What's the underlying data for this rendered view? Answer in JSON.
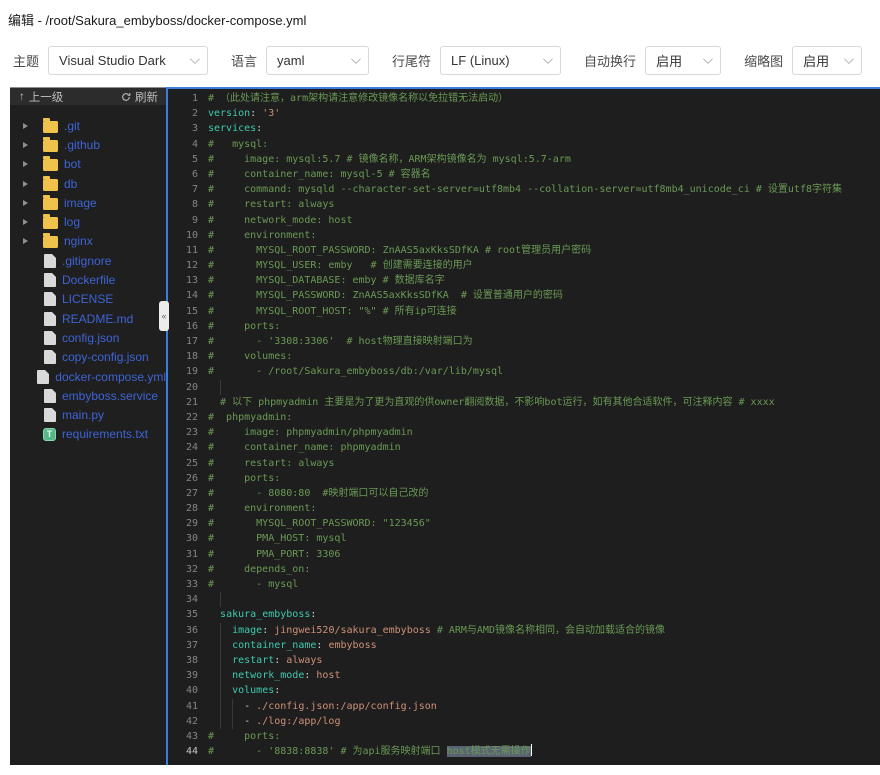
{
  "window": {
    "title": "编辑 - /root/Sakura_embyboss/docker-compose.yml"
  },
  "toolbar": {
    "fields": [
      {
        "label": "主题",
        "value": "Visual Studio Dark"
      },
      {
        "label": "语言",
        "value": "yaml"
      },
      {
        "label": "行尾符",
        "value": "LF (Linux)"
      },
      {
        "label": "自动换行",
        "value": "启用"
      },
      {
        "label": "缩略图",
        "value": "启用"
      }
    ]
  },
  "sidebar": {
    "up_label": "上一级",
    "refresh_label": "刷新",
    "collapse_icon": "«",
    "items": [
      {
        "name": ".git",
        "type": "folder"
      },
      {
        "name": ".github",
        "type": "folder"
      },
      {
        "name": "bot",
        "type": "folder"
      },
      {
        "name": "db",
        "type": "folder"
      },
      {
        "name": "image",
        "type": "folder"
      },
      {
        "name": "log",
        "type": "folder"
      },
      {
        "name": "nginx",
        "type": "folder"
      },
      {
        "name": ".gitignore",
        "type": "file"
      },
      {
        "name": "Dockerfile",
        "type": "file"
      },
      {
        "name": "LICENSE",
        "type": "file"
      },
      {
        "name": "README.md",
        "type": "file"
      },
      {
        "name": "config.json",
        "type": "file"
      },
      {
        "name": "copy-config.json",
        "type": "file"
      },
      {
        "name": "docker-compose.yml",
        "type": "file"
      },
      {
        "name": "embyboss.service",
        "type": "file"
      },
      {
        "name": "main.py",
        "type": "file"
      },
      {
        "name": "requirements.txt",
        "type": "txt"
      }
    ]
  },
  "colors": {
    "accent_blue": "#3b7ddd",
    "editor_bg": "#1e1e1e",
    "comment_green": "#6a9955",
    "key_teal": "#3dc9b0",
    "value_orange": "#ce9178",
    "selection_gray": "#5a6372",
    "tree_link_blue": "#3e63d6",
    "folder_yellow": "#f0c14b",
    "txt_icon_green": "#55b888"
  },
  "editor": {
    "lines": [
      {
        "n": 1,
        "tokens": [
          {
            "c": "c",
            "t": "# （此处请注意，arm架构请注意修改镜像名称以免拉错无法启动）"
          }
        ]
      },
      {
        "n": 2,
        "tokens": [
          {
            "c": "k",
            "t": "version"
          },
          {
            "c": "p",
            "t": ": "
          },
          {
            "c": "s",
            "t": "'3'"
          }
        ]
      },
      {
        "n": 3,
        "tokens": [
          {
            "c": "k",
            "t": "services"
          },
          {
            "c": "p",
            "t": ":"
          }
        ]
      },
      {
        "n": 4,
        "tokens": [
          {
            "c": "c",
            "t": "#   mysql:"
          }
        ]
      },
      {
        "n": 5,
        "tokens": [
          {
            "c": "c",
            "t": "#     image: mysql:5.7 # 镜像名称，ARM架构镜像名为 mysql:5.7-arm"
          }
        ]
      },
      {
        "n": 6,
        "tokens": [
          {
            "c": "c",
            "t": "#     container_name: mysql-5 # 容器名"
          }
        ]
      },
      {
        "n": 7,
        "tokens": [
          {
            "c": "c",
            "t": "#     command: mysqld --character-set-server=utf8mb4 --collation-server=utf8mb4_unicode_ci # 设置utf8字符集"
          }
        ]
      },
      {
        "n": 8,
        "tokens": [
          {
            "c": "c",
            "t": "#     restart: always"
          }
        ]
      },
      {
        "n": 9,
        "tokens": [
          {
            "c": "c",
            "t": "#     network_mode: host"
          }
        ]
      },
      {
        "n": 10,
        "tokens": [
          {
            "c": "c",
            "t": "#     environment:"
          }
        ]
      },
      {
        "n": 11,
        "tokens": [
          {
            "c": "c",
            "t": "#       MYSQL_ROOT_PASSWORD: ZnAAS5axKksSDfKA # root管理员用户密码"
          }
        ]
      },
      {
        "n": 12,
        "tokens": [
          {
            "c": "c",
            "t": "#       MYSQL_USER: emby   # 创建需要连接的用户"
          }
        ]
      },
      {
        "n": 13,
        "tokens": [
          {
            "c": "c",
            "t": "#       MYSQL_DATABASE: emby # 数据库名字"
          }
        ]
      },
      {
        "n": 14,
        "tokens": [
          {
            "c": "c",
            "t": "#       MYSQL_PASSWORD: ZnAAS5axKksSDfKA  # 设置普通用户的密码"
          }
        ]
      },
      {
        "n": 15,
        "tokens": [
          {
            "c": "c",
            "t": "#       MYSQL_ROOT_HOST: \"%\" # 所有ip可连接"
          }
        ]
      },
      {
        "n": 16,
        "tokens": [
          {
            "c": "c",
            "t": "#     ports:"
          }
        ]
      },
      {
        "n": 17,
        "tokens": [
          {
            "c": "c",
            "t": "#       - '3308:3306'  # host物理直接映射端口为"
          }
        ]
      },
      {
        "n": 18,
        "tokens": [
          {
            "c": "c",
            "t": "#     volumes:"
          }
        ]
      },
      {
        "n": 19,
        "tokens": [
          {
            "c": "c",
            "t": "#       - /root/Sakura_embyboss/db:/var/lib/mysql"
          }
        ]
      },
      {
        "n": 20,
        "guides": [
          2
        ],
        "tokens": []
      },
      {
        "n": 21,
        "tokens": [
          {
            "c": "c",
            "t": "  # 以下 phpmyadmin 主要是为了更为直观的供owner翻阅数据，不影响bot运行，如有其他合适软件，可注释内容 # xxxx"
          }
        ]
      },
      {
        "n": 22,
        "tokens": [
          {
            "c": "c",
            "t": "#  phpmyadmin:"
          }
        ]
      },
      {
        "n": 23,
        "tokens": [
          {
            "c": "c",
            "t": "#     image: phpmyadmin/phpmyadmin"
          }
        ]
      },
      {
        "n": 24,
        "tokens": [
          {
            "c": "c",
            "t": "#     container_name: phpmyadmin"
          }
        ]
      },
      {
        "n": 25,
        "tokens": [
          {
            "c": "c",
            "t": "#     restart: always"
          }
        ]
      },
      {
        "n": 26,
        "tokens": [
          {
            "c": "c",
            "t": "#     ports:"
          }
        ]
      },
      {
        "n": 27,
        "tokens": [
          {
            "c": "c",
            "t": "#       - 8080:80  #映射端口可以自己改的"
          }
        ]
      },
      {
        "n": 28,
        "tokens": [
          {
            "c": "c",
            "t": "#     environment:"
          }
        ]
      },
      {
        "n": 29,
        "tokens": [
          {
            "c": "c",
            "t": "#       MYSQL_ROOT_PASSWORD: \"123456\""
          }
        ]
      },
      {
        "n": 30,
        "tokens": [
          {
            "c": "c",
            "t": "#       PMA_HOST: mysql"
          }
        ]
      },
      {
        "n": 31,
        "tokens": [
          {
            "c": "c",
            "t": "#       PMA_PORT: 3306"
          }
        ]
      },
      {
        "n": 32,
        "tokens": [
          {
            "c": "c",
            "t": "#     depends_on:"
          }
        ]
      },
      {
        "n": 33,
        "tokens": [
          {
            "c": "c",
            "t": "#       - mysql"
          }
        ]
      },
      {
        "n": 34,
        "guides": [
          2
        ],
        "tokens": []
      },
      {
        "n": 35,
        "tokens": [
          {
            "c": "p",
            "t": "  "
          },
          {
            "c": "k",
            "t": "sakura_embyboss"
          },
          {
            "c": "p",
            "t": ":"
          }
        ]
      },
      {
        "n": 36,
        "guides": [
          2
        ],
        "tokens": [
          {
            "c": "p",
            "t": "    "
          },
          {
            "c": "k",
            "t": "image"
          },
          {
            "c": "p",
            "t": ":"
          },
          {
            "c": "s",
            "t": " jingwei520/sakura_embyboss "
          },
          {
            "c": "c",
            "t": "# ARM与AMD镜像名称相同，会自动加载适合的镜像"
          }
        ]
      },
      {
        "n": 37,
        "guides": [
          2
        ],
        "tokens": [
          {
            "c": "p",
            "t": "    "
          },
          {
            "c": "k",
            "t": "container_name"
          },
          {
            "c": "p",
            "t": ":"
          },
          {
            "c": "s",
            "t": " embyboss"
          }
        ]
      },
      {
        "n": 38,
        "guides": [
          2
        ],
        "tokens": [
          {
            "c": "p",
            "t": "    "
          },
          {
            "c": "k",
            "t": "restart"
          },
          {
            "c": "p",
            "t": ":"
          },
          {
            "c": "s",
            "t": " always"
          }
        ]
      },
      {
        "n": 39,
        "guides": [
          2
        ],
        "tokens": [
          {
            "c": "p",
            "t": "    "
          },
          {
            "c": "k",
            "t": "network_mode"
          },
          {
            "c": "p",
            "t": ":"
          },
          {
            "c": "s",
            "t": " host"
          }
        ]
      },
      {
        "n": 40,
        "guides": [
          2
        ],
        "tokens": [
          {
            "c": "p",
            "t": "    "
          },
          {
            "c": "k",
            "t": "volumes"
          },
          {
            "c": "p",
            "t": ":"
          }
        ]
      },
      {
        "n": 41,
        "guides": [
          2,
          4
        ],
        "tokens": [
          {
            "c": "p",
            "t": "      - "
          },
          {
            "c": "s",
            "t": "./config.json:/app/config.json"
          }
        ]
      },
      {
        "n": 42,
        "guides": [
          2,
          4
        ],
        "tokens": [
          {
            "c": "p",
            "t": "      - "
          },
          {
            "c": "s",
            "t": "./log:/app/log"
          }
        ]
      },
      {
        "n": 43,
        "tokens": [
          {
            "c": "c",
            "t": "#     ports:"
          }
        ]
      },
      {
        "n": 44,
        "active": true,
        "tokens": [
          {
            "c": "c",
            "t": "#       - '8838:8838' # 为api服务映射端口 "
          },
          {
            "c": "c sel",
            "t": "host模式无需操作"
          },
          {
            "caret": true
          }
        ]
      }
    ]
  }
}
